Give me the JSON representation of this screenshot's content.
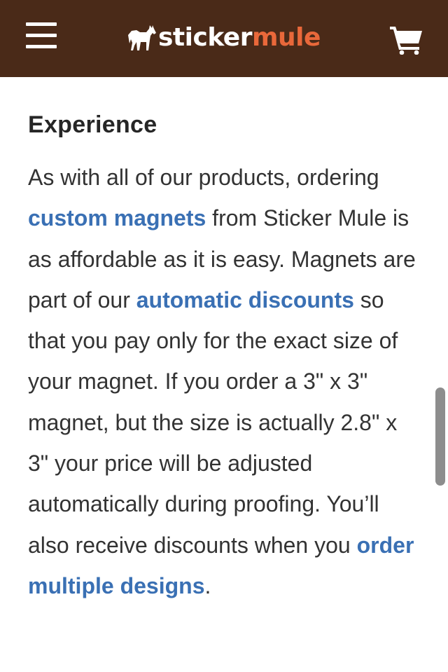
{
  "header": {
    "brand_part1": "sticker",
    "brand_part2": "mule",
    "menu_icon": "hamburger-menu-icon",
    "cart_icon": "shopping-cart-icon",
    "bg_color": "#4a2a18",
    "brand_accent": "#e9683a"
  },
  "article": {
    "heading": "Experience",
    "t1": "As with all of our products, ordering ",
    "link1": "custom magnets",
    "t2": " from Sticker Mule is as affordable as it is easy. Magnets are part of our ",
    "link2": "automatic discounts",
    "t3": " so that you pay only for the exact size of your magnet. If you order a 3\" x 3\" magnet, but the size is actually 2.8\" x 3\" your price will be adjusted automatically during proofing. You’ll also receive discounts when you ",
    "link3": "order multiple designs",
    "t4": ".",
    "link_color": "#3a70b4"
  }
}
